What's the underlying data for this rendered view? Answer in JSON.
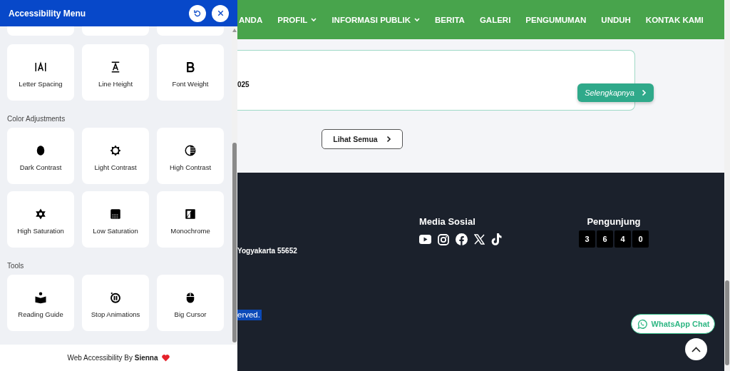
{
  "accessibility_menu": {
    "title": "Accessibility Menu",
    "sections": [
      {
        "items": [
          {
            "label": "Letter Spacing"
          },
          {
            "label": "Line Height"
          },
          {
            "label": "Font Weight"
          }
        ]
      },
      {
        "heading": "Color Adjustments",
        "items": [
          {
            "label": "Dark Contrast"
          },
          {
            "label": "Light Contrast"
          },
          {
            "label": "High Contrast"
          },
          {
            "label": "High Saturation"
          },
          {
            "label": "Low Saturation"
          },
          {
            "label": "Monochrome"
          }
        ]
      },
      {
        "heading": "Tools",
        "items": [
          {
            "label": "Reading Guide"
          },
          {
            "label": "Stop Animations"
          },
          {
            "label": "Big Cursor"
          }
        ]
      }
    ],
    "credit": "Web Accessibility By **Sienna**"
  },
  "nav": {
    "items": [
      {
        "label": "ANDA",
        "dropdown": false
      },
      {
        "label": "PROFIL",
        "dropdown": true
      },
      {
        "label": "INFORMASI PUBLIK",
        "dropdown": true
      },
      {
        "label": "BERITA",
        "dropdown": false
      },
      {
        "label": "GALERI",
        "dropdown": false
      },
      {
        "label": "PENGUMUMAN",
        "dropdown": false
      },
      {
        "label": "UNDUH",
        "dropdown": false
      },
      {
        "label": "KONTAK KAMI",
        "dropdown": false
      }
    ]
  },
  "content": {
    "card_text": "025",
    "more_button": "Selengkapnya",
    "see_all_button": "Lihat Semua"
  },
  "footer": {
    "address": "Yogyakarta 55652",
    "copyright": "erved.",
    "social_heading": "Media Sosial",
    "visitors_heading": "Pengunjung",
    "visitor_digits": [
      "3",
      "6",
      "4",
      "0"
    ],
    "whatsapp_button": "WhatsApp Chat"
  }
}
